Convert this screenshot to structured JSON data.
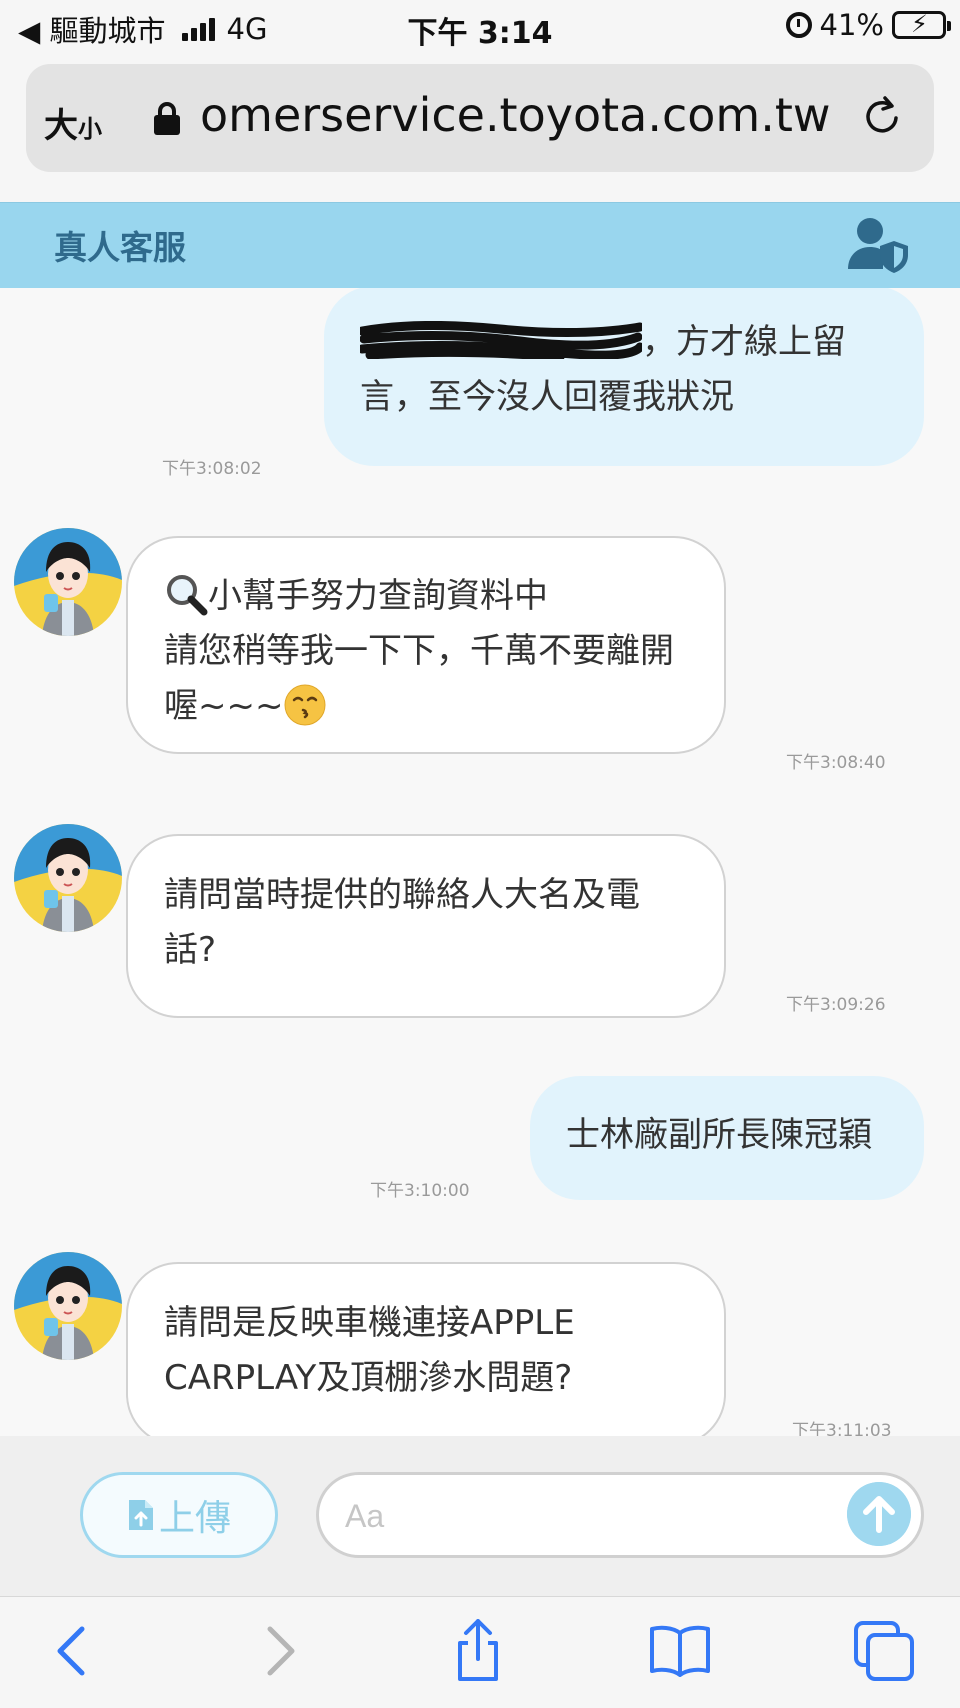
{
  "status_bar": {
    "back_label": "◀ 驅動城市",
    "network": "4G",
    "time": "下午 3:14",
    "battery": "41%",
    "battery_level": 0.41
  },
  "browser": {
    "text_size_label": "大",
    "text_size_small": "小",
    "url": "omerservice.toyota.com.tw"
  },
  "header": {
    "title": "真人客服"
  },
  "messages": [
    {
      "from": "user",
      "text": "，方才線上留言，至今沒人回覆我狀況",
      "time": "下午3:08:02"
    },
    {
      "from": "bot",
      "line1": "小幫手努力查詢資料中",
      "line2": "請您稍等我一下下，千萬不要離開喔~~~",
      "time": "下午3:08:40"
    },
    {
      "from": "bot",
      "text": "請問當時提供的聯絡人大名及電話?",
      "time": "下午3:09:26"
    },
    {
      "from": "user",
      "text": "士林廠副所長陳冠穎",
      "time": "下午3:10:00"
    },
    {
      "from": "bot",
      "text": "請問是反映車機連接APPLE CARPLAY及頂棚滲水問題?",
      "time": "下午3:11:03"
    }
  ],
  "input": {
    "upload_label": "上傳",
    "placeholder": "Aa"
  },
  "colors": {
    "header_bg": "#99d6ee",
    "header_text": "#2f6a8c",
    "user_bubble": "#e1f3fc",
    "accent": "#9fd8ef",
    "toolbar_icon": "#3478f6"
  },
  "icons": {
    "lock": "lock-icon",
    "reload": "reload-icon",
    "agent": "agent-shield-icon",
    "upload": "file-upload-icon",
    "send": "arrow-up-icon",
    "back": "chevron-left-icon",
    "forward": "chevron-right-icon",
    "share": "share-icon",
    "bookmarks": "book-icon",
    "tabs": "tabs-icon"
  }
}
